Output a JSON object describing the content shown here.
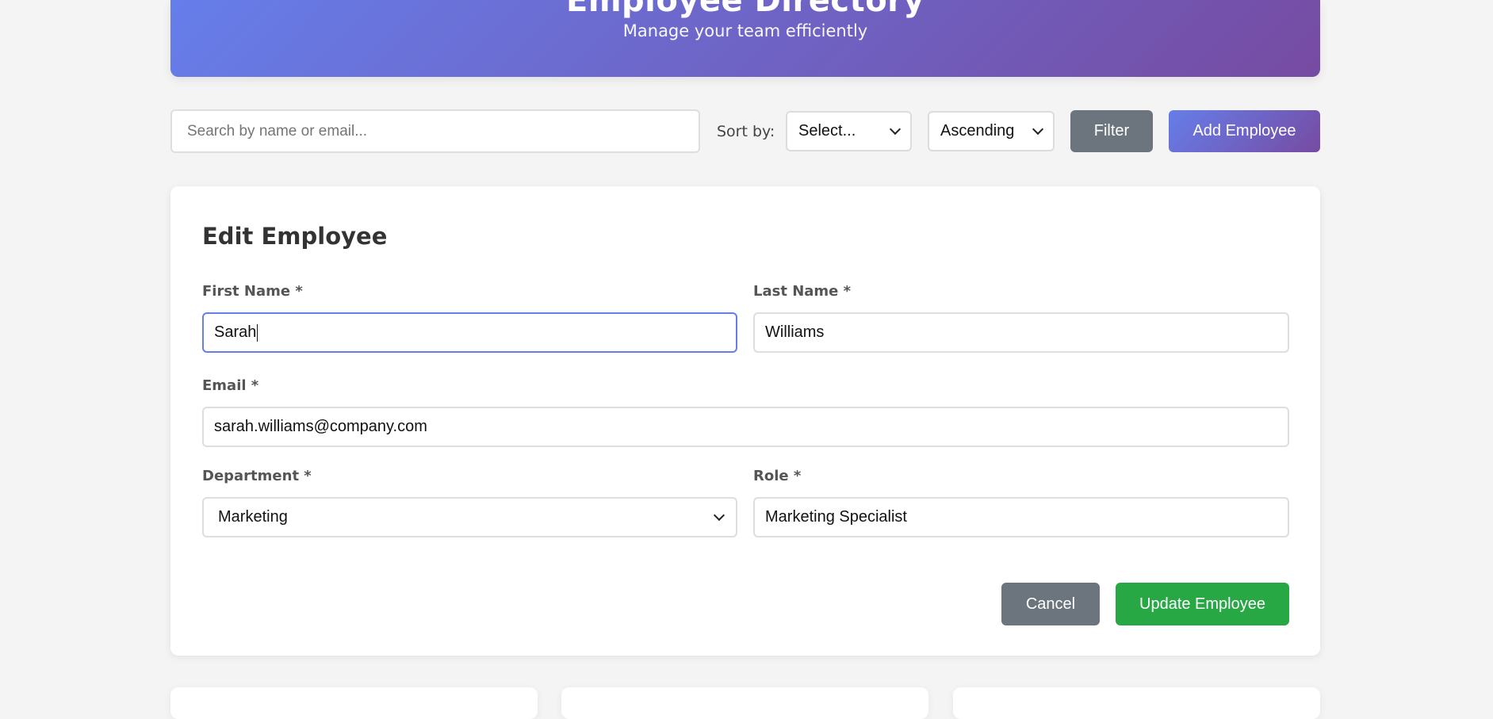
{
  "header": {
    "title": "Employee Directory",
    "subtitle": "Manage your team efficiently"
  },
  "toolbar": {
    "search_placeholder": "Search by name or email...",
    "search_value": "",
    "sort_label": "Sort by:",
    "sort_field_value": "Select...",
    "sort_order_value": "Ascending",
    "filter_label": "Filter",
    "add_label": "Add Employee"
  },
  "form": {
    "title": "Edit Employee",
    "first_name": {
      "label": "First Name *",
      "value": "Sarah"
    },
    "last_name": {
      "label": "Last Name *",
      "value": "Williams"
    },
    "email": {
      "label": "Email *",
      "value": "sarah.williams@company.com"
    },
    "department": {
      "label": "Department *",
      "value": "Marketing"
    },
    "role": {
      "label": "Role *",
      "value": "Marketing Specialist"
    },
    "cancel_label": "Cancel",
    "update_label": "Update Employee"
  },
  "colors": {
    "accent_gradient_start": "#667eea",
    "accent_gradient_end": "#764ba2",
    "secondary_button": "#6c757d",
    "success_button": "#28a745",
    "focus_border": "#667eea"
  }
}
